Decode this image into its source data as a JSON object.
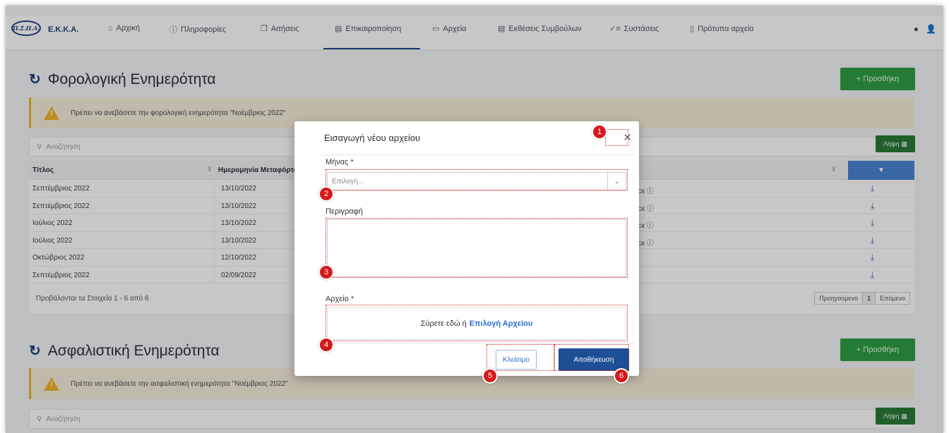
{
  "brand": {
    "logo_text": "Π.Σ.Π.Α.",
    "name": "E.K.K.A."
  },
  "nav": [
    {
      "icon": "home-icon",
      "label": "Αρχική"
    },
    {
      "icon": "info-icon",
      "label": "Πληροφορίες"
    },
    {
      "icon": "document-icon",
      "label": "Αιτήσεις"
    },
    {
      "icon": "refresh-doc-icon",
      "label": "Επικαιροποίηση",
      "active": true
    },
    {
      "icon": "folder-icon",
      "label": "Αρχεία"
    },
    {
      "icon": "report-icon",
      "label": "Εκθέσεις Συμβούλων"
    },
    {
      "icon": "checklist-icon",
      "label": "Συστάσεις"
    },
    {
      "icon": "file-icon",
      "label": "Πρότυπα αρχεία"
    }
  ],
  "section1": {
    "title": "Φορολογική Ενημερότητα",
    "add_label": "+ Προσθήκη",
    "alert": "Πρέπει να ανεβάσετε την φορολογική ενημερότητα \"Νοέμβριος 2022\"",
    "search_placeholder": "Αναζήτηση",
    "export_label": "Λήψη"
  },
  "table": {
    "headers": {
      "title": "Τίτλος",
      "date": "Ημερομηνία Μεταφόρτωσ"
    },
    "rows": [
      {
        "title": "Σεπτέμβριος 2022",
        "date": "13/10/2022",
        "extra": "cx ⓘ"
      },
      {
        "title": "Σεπτέμβριος 2022",
        "date": "13/10/2022",
        "extra": "cx ⓘ"
      },
      {
        "title": "Ιούλιος 2022",
        "date": "13/10/2022",
        "extra": "cx ⓘ"
      },
      {
        "title": "Ιούλιος 2022",
        "date": "13/10/2022",
        "extra": "cx ⓘ"
      },
      {
        "title": "Οκτώβριος 2022",
        "date": "12/10/2022",
        "extra": ""
      },
      {
        "title": "Σεπτέμβριος 2022",
        "date": "02/09/2022",
        "extra": ""
      }
    ],
    "footer_info": "Προβάλονται τα Στοιχεία 1 - 6 από 6",
    "pager": {
      "prev": "Προηγούμενο",
      "current": "1",
      "next": "Επόμενο"
    }
  },
  "section2": {
    "title": "Ασφαλιστική Ενημερότητα",
    "add_label": "+ Προσθήκη",
    "alert": "Πρέπει να ανεβάσετε την ασφαλιστική ενημερότητα \"Νοέμβριος 2022\"",
    "search_placeholder": "Αναζήτηση",
    "export_label": "Λήψη"
  },
  "modal": {
    "title": "Εισαγωγή νέου αρχείου",
    "month_label": "Μήνας *",
    "month_placeholder": "Επιλογή...",
    "description_label": "Περιγραφή",
    "file_label": "Αρχείο *",
    "drop_text": "Σύρετε εδώ ή",
    "drop_link": "Επιλογή Αρχείου",
    "close_label": "Κλείσιμο",
    "save_label": "Αποθήκευση"
  },
  "markers": [
    "1",
    "2",
    "3",
    "4",
    "5",
    "6"
  ],
  "colors": {
    "accent": "#1d4e96",
    "add_button": "#2f9e44",
    "marker": "#d6191c",
    "alert_bg": "#f6efdc",
    "warning": "#f0b429"
  }
}
